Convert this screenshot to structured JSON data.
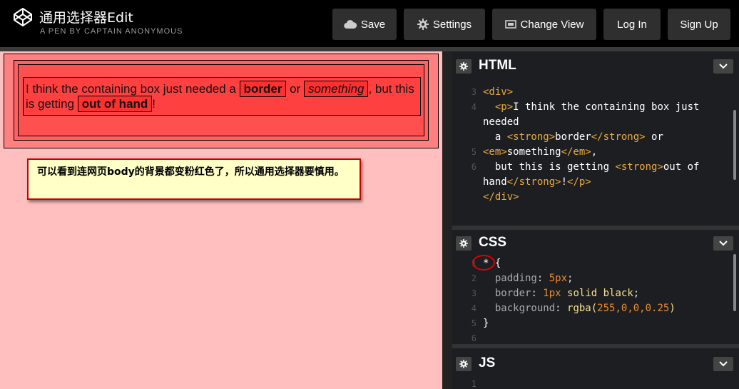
{
  "header": {
    "title": "通用选择器Edit",
    "subtitle": "A PEN BY CAPTAIN ANONYMOUS",
    "buttons": {
      "save": "Save",
      "settings": "Settings",
      "change_view": "Change View",
      "login": "Log In",
      "signup": "Sign Up"
    }
  },
  "preview": {
    "text_1": "I think the containing box just needed a ",
    "strong_1": "border",
    "text_2": " or ",
    "em_1": "something",
    "text_3": ", but this is getting ",
    "strong_2": "out of hand",
    "text_4": "!",
    "note": "可以看到连网页body的背景都变粉红色了，所以通用选择器要慎用。"
  },
  "editors": {
    "html": {
      "title": "HTML",
      "line_numbers": [
        "3",
        "4",
        "",
        "5",
        "",
        "6",
        "",
        ""
      ]
    },
    "css": {
      "title": "CSS",
      "line_numbers": [
        "1",
        "2",
        "3",
        "4",
        "5",
        "6"
      ],
      "code": {
        "selector": "*",
        "open": " {",
        "prop_padding": "padding",
        "val_padding": "5px",
        "prop_border": "border",
        "val_border_num": "1px",
        "val_border_rest": "solid black",
        "prop_background": "background",
        "val_bg_fn": "rgba(",
        "val_bg_args": "255,0,0,0.25",
        "val_bg_close": ")",
        "close": "}"
      }
    },
    "js": {
      "title": "JS",
      "line_numbers": [
        "1"
      ]
    }
  },
  "colors": {
    "annotation_circle": "#e00000",
    "note_border": "#c80000",
    "tag": "#e8a93b",
    "number": "#e88a2e"
  },
  "icons": [
    "codepen-logo-icon",
    "cloud-icon",
    "gear-icon",
    "monitor-icon",
    "chevron-down-icon"
  ]
}
